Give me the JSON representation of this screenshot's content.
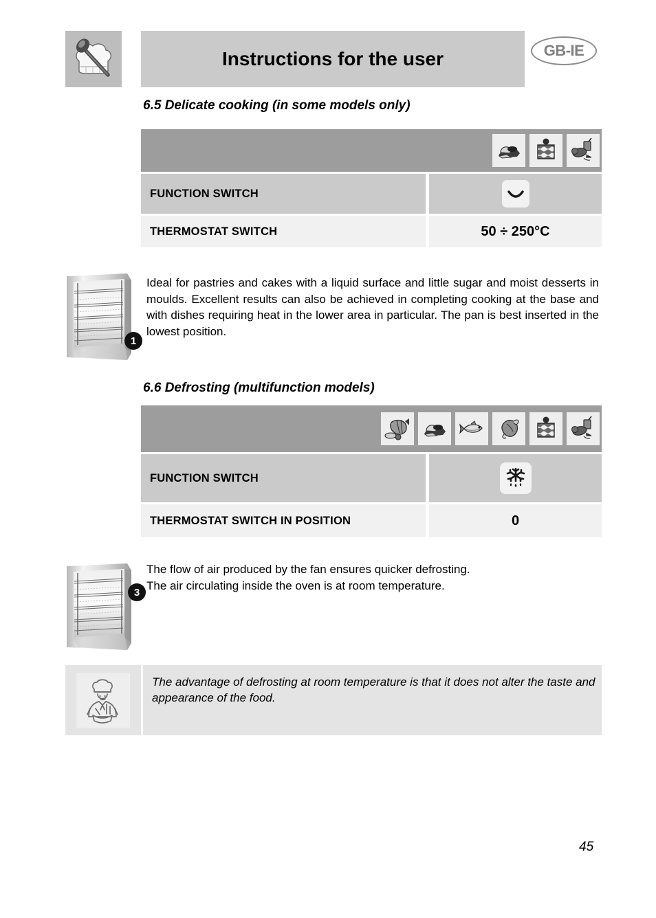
{
  "header": {
    "title": "Instructions for the user",
    "language_badge": "GB-IE",
    "icon": "chef-hat-spoon-icon"
  },
  "sections": [
    {
      "id": "6.5",
      "heading": "6.5 Delicate cooking (in some models only)",
      "food_icons": [
        "bread-icon",
        "cake-slice-icon",
        "roast-vegetables-icon"
      ],
      "rows": [
        {
          "label": "FUNCTION SWITCH",
          "value": "",
          "symbol": "bottom-heating-arc-icon"
        },
        {
          "label": "THERMOSTAT SWITCH",
          "value": "50 ÷ 250°C",
          "symbol": ""
        }
      ],
      "oven_badge": "1",
      "body": "Ideal for pastries and cakes with a liquid surface and little sugar and moist desserts in moulds. Excellent results can also be achieved in completing cooking at the base and with dishes requiring heat in the lower area in particular. The pan is best inserted in the lowest position."
    },
    {
      "id": "6.6",
      "heading": "6.6 Defrosting (multifunction models)",
      "food_icons": [
        "ham-icon",
        "bread-icon",
        "fish-icon",
        "chicken-icon",
        "cake-slice-icon",
        "roast-vegetables-icon"
      ],
      "rows": [
        {
          "label": "FUNCTION SWITCH",
          "value": "",
          "symbol": "snowflake-defrost-icon"
        },
        {
          "label": "THERMOSTAT SWITCH IN POSITION",
          "value": "0",
          "symbol": ""
        }
      ],
      "oven_badge": "3",
      "body_line_1": "The flow of air produced by the fan ensures quicker defrosting.",
      "body_line_2": "The air circulating inside the oven is at room temperature."
    }
  ],
  "tip": {
    "icon": "chef-cooking-icon",
    "text": "The advantage of defrosting at room temperature is that it does not alter the taste and appearance of the food."
  },
  "page_number": "45",
  "colors": {
    "header_bar": "#cacaca",
    "table_iconbar": "#9d9d9d",
    "row_dark": "#cacaca",
    "row_light": "#f1f1f1",
    "tip_background": "#e4e4e4",
    "badge_text": "#808080"
  }
}
